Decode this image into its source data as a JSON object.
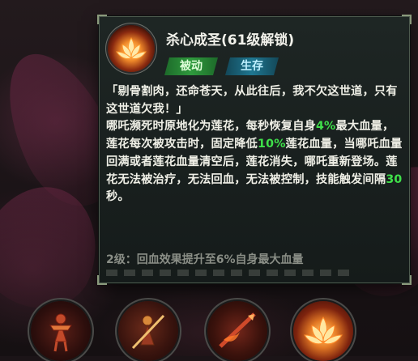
{
  "skill": {
    "icon": "lotus-flame-icon",
    "title": "杀心成圣(61级解锁)",
    "tags": {
      "passive": "被动",
      "survive": "生存"
    }
  },
  "description": {
    "segments": [
      "「剔骨割肉，还命苍天，从此往后，我不欠这世道，只有这世道欠我！」",
      "哪吒濒死时原地化为莲花，每秒恢复自身",
      "4%",
      "最大血量，莲花每次被攻击时，固定降低",
      "10%",
      "莲花血量，当哪吒血量回满或者莲花血量清空后，莲花消失，哪吒重新登场。莲花无法被治疗，无法回血，无法被控制，技能触发间隔",
      "30",
      "秒。"
    ]
  },
  "level_note": "2级：回血效果提升至6%自身最大血量",
  "skill_slots": [
    {
      "icon": "nezha-figure-icon"
    },
    {
      "icon": "nezha-spear-icon"
    },
    {
      "icon": "fire-spear-icon"
    },
    {
      "icon": "lotus-flame-icon"
    }
  ],
  "colors": {
    "highlight": "#3fe04a",
    "passive_tag": "#2f9a3d",
    "survive_tag": "#1f7791"
  }
}
